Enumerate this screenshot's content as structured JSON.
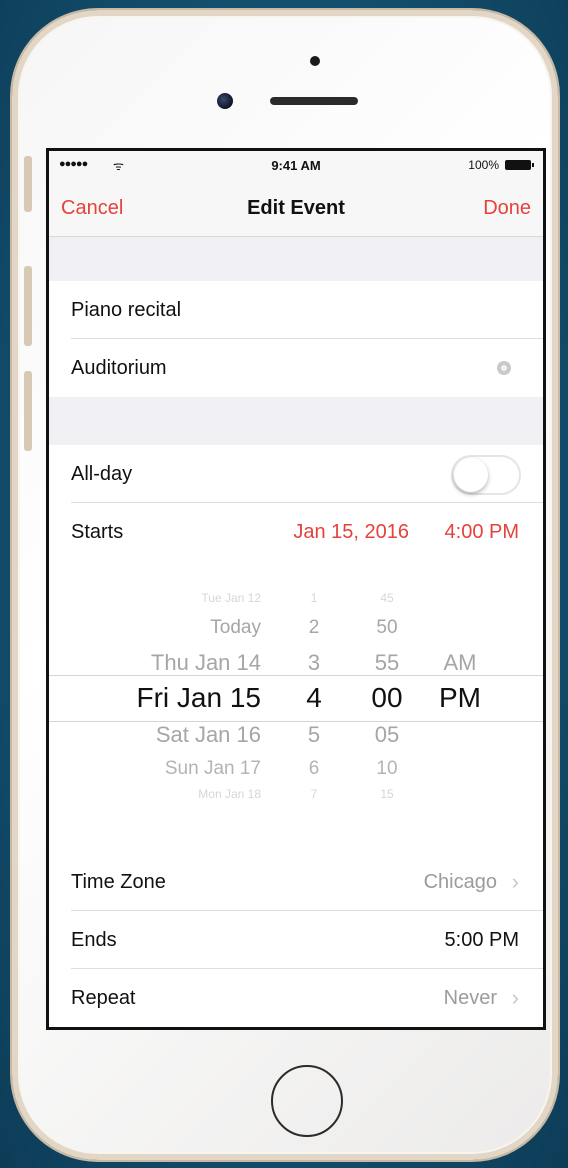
{
  "status_bar": {
    "signal": "●●●●●",
    "wifi": "ᯤ",
    "time": "9:41 AM",
    "battery": "100%"
  },
  "nav": {
    "cancel": "Cancel",
    "title": "Edit Event",
    "done": "Done"
  },
  "event": {
    "title": "Piano recital",
    "location": "Auditorium"
  },
  "all_day": {
    "label": "All-day",
    "on": false
  },
  "starts": {
    "label": "Starts",
    "date": "Jan 15, 2016",
    "time": "4:00 PM"
  },
  "picker": {
    "dates": [
      "Tue Jan 12",
      "Today",
      "Thu Jan 14",
      "Fri Jan 15",
      "Sat Jan 16",
      "Sun Jan 17",
      "Mon Jan 18"
    ],
    "hours": [
      "1",
      "2",
      "3",
      "4",
      "5",
      "6",
      "7"
    ],
    "minutes": [
      "45",
      "50",
      "55",
      "00",
      "05",
      "10",
      "15"
    ],
    "ampm": [
      "AM",
      "PM"
    ],
    "selected_index": 3
  },
  "time_zone": {
    "label": "Time Zone",
    "value": "Chicago"
  },
  "ends": {
    "label": "Ends",
    "value": "5:00 PM"
  },
  "repeat": {
    "label": "Repeat",
    "value": "Never"
  },
  "colors": {
    "accent": "#e5423c",
    "background": "#155676"
  }
}
